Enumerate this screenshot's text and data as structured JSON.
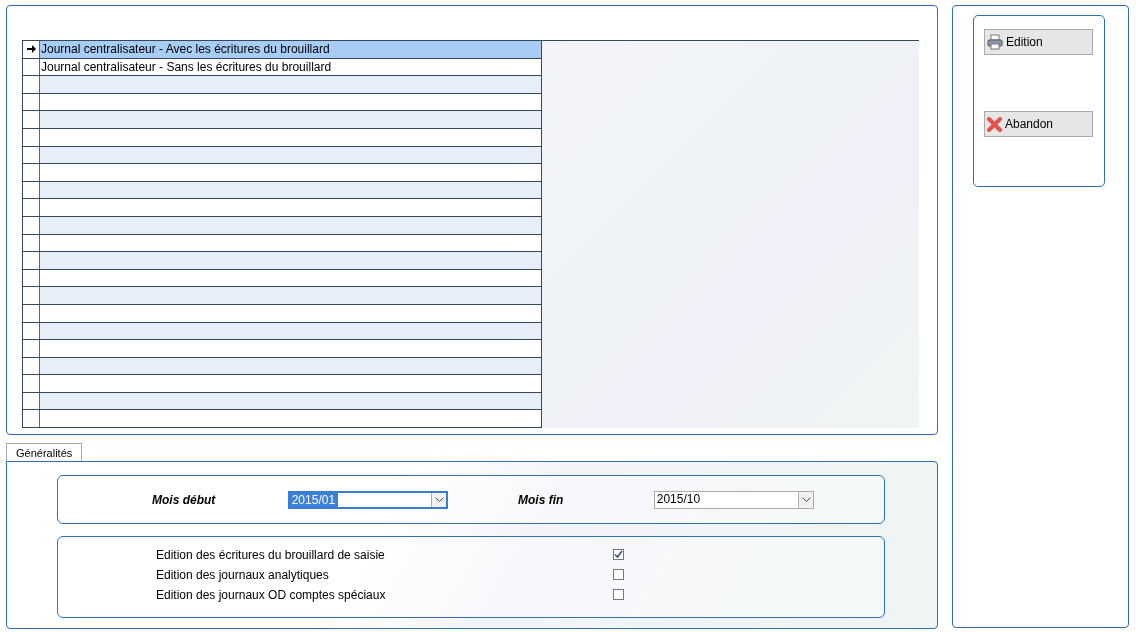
{
  "journals": [
    {
      "label": "Journal centralisateur - Avec les écritures du brouillard",
      "selected": true
    },
    {
      "label": "Journal centralisateur - Sans les écritures du brouillard",
      "selected": false
    }
  ],
  "actions": [
    {
      "label": "Edition",
      "kind": "print"
    },
    {
      "label": "Abandon",
      "kind": "cancel"
    }
  ],
  "tabs": [
    {
      "label": "Généralités",
      "selected": true
    }
  ],
  "period": [
    {
      "label": "Mois début",
      "value": "2015/01",
      "focused": true
    },
    {
      "label": "Mois fin",
      "value": "2015/10",
      "focused": false
    }
  ],
  "options": [
    {
      "label": "Edition des écritures du brouillard de saisie",
      "checked": true
    },
    {
      "label": "Edition des journaux analytiques",
      "checked": false
    },
    {
      "label": "Edition des journaux OD comptes spéciaux",
      "checked": false
    }
  ]
}
